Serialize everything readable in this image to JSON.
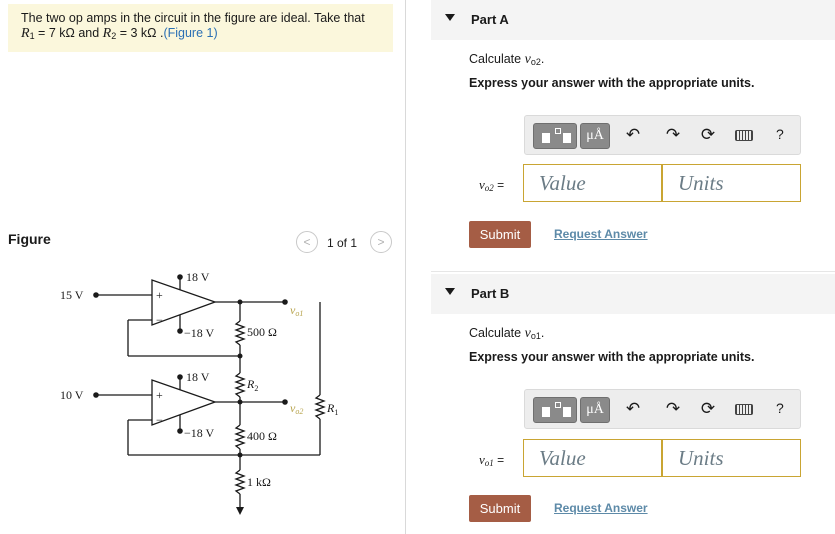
{
  "problem": {
    "text_a": "The two op amps in the circuit in the figure are ideal. Take that",
    "r1_symbol": "R",
    "r1_sub": "1",
    "r1_value": " = 7 kΩ and ",
    "r2_symbol": "R",
    "r2_sub": "2",
    "r2_value": " = 3 kΩ .",
    "figure_link": "(Figure 1)"
  },
  "figure": {
    "label": "Figure",
    "prev": "<",
    "next": ">",
    "page_count": "1 of 1",
    "circuit_labels": {
      "v15": "15 V",
      "v10": "10 V",
      "rail_top1": "18 V",
      "rail_bot1": "−18 V",
      "rail_top2": "18 V",
      "rail_bot2": "−18 V",
      "r500": "500 Ω",
      "r2": "R",
      "r2_sub": "2",
      "r1": "R",
      "r1_sub": "1",
      "r400": "400 Ω",
      "r1k": "1 kΩ",
      "vo1": "v",
      "vo1_sub": "o1",
      "vo2": "v",
      "vo2_sub": "o2",
      "plus": "+",
      "minus": "−"
    }
  },
  "partA": {
    "title": "Part A",
    "calc_prefix": "Calculate ",
    "calc_var": "v",
    "calc_sub": "o2",
    "calc_suffix": ".",
    "express": "Express your answer with the appropriate units.",
    "units_btn": "μÅ",
    "help": "?",
    "var": "v",
    "var_sub": "o2",
    "eq": " =",
    "value_placeholder": "Value",
    "units_placeholder": "Units",
    "submit": "Submit",
    "request": "Request Answer"
  },
  "partB": {
    "title": "Part B",
    "calc_prefix": "Calculate ",
    "calc_var": "v",
    "calc_sub": "o1",
    "calc_suffix": ".",
    "express": "Express your answer with the appropriate units.",
    "units_btn": "μÅ",
    "help": "?",
    "var": "v",
    "var_sub": "o1",
    "eq": " =",
    "value_placeholder": "Value",
    "units_placeholder": "Units",
    "submit": "Submit",
    "request": "Request Answer"
  },
  "icons": {
    "undo": "undo-icon",
    "redo": "redo-icon",
    "reset": "reset-icon",
    "keyboard": "keyboard-icon",
    "template": "template-icon"
  },
  "colors": {
    "problem_bg": "#fbf7dc",
    "link": "#2a6fb4",
    "submit_bg": "#a55d45",
    "field_border": "#c9a533",
    "request_link": "#5d8aa8"
  }
}
